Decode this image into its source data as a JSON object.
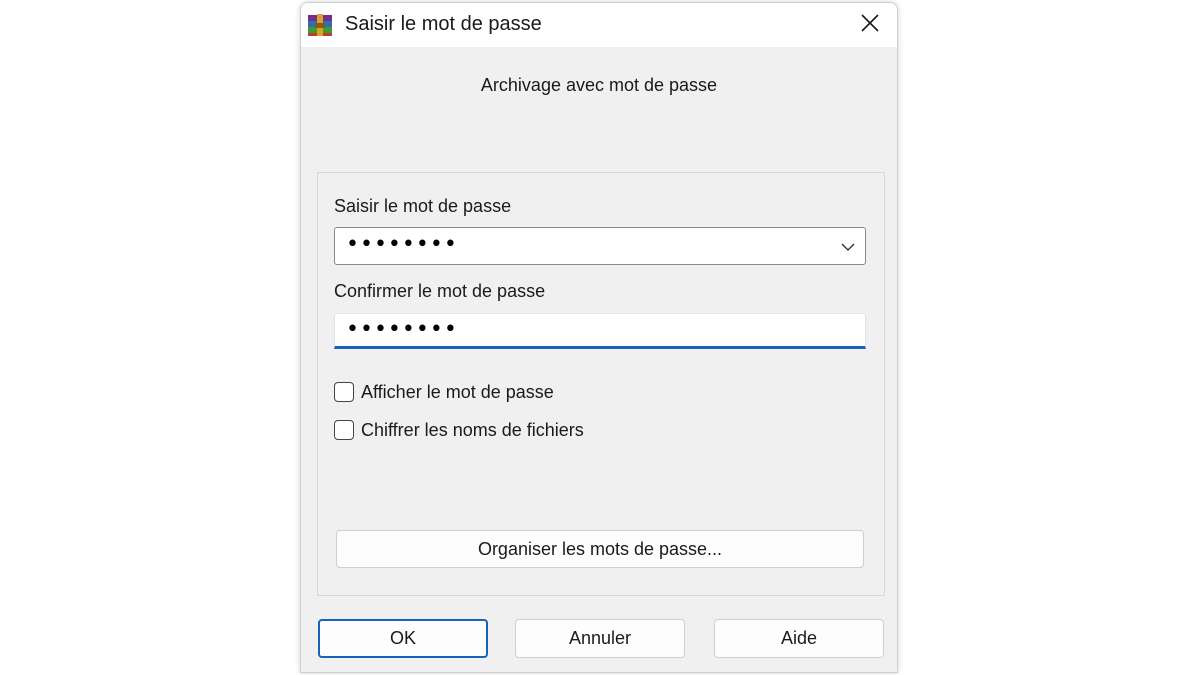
{
  "window": {
    "title": "Saisir le mot de passe",
    "app_icon": "winrar-icon",
    "close_icon": "close-icon"
  },
  "subtitle": "Archivage avec mot de passe",
  "fields": {
    "password_label": "Saisir le mot de passe",
    "password_value": "••••••••",
    "confirm_label": "Confirmer le mot de passe",
    "confirm_value": "••••••••"
  },
  "options": [
    {
      "label": "Afficher le mot de passe",
      "checked": false
    },
    {
      "label": "Chiffrer les noms de fichiers",
      "checked": false
    }
  ],
  "buttons": {
    "organize": "Organiser les mots de passe...",
    "ok": "OK",
    "cancel": "Annuler",
    "help": "Aide"
  },
  "colors": {
    "accent": "#1764b6",
    "dialog_bg": "#f0f0f0"
  }
}
